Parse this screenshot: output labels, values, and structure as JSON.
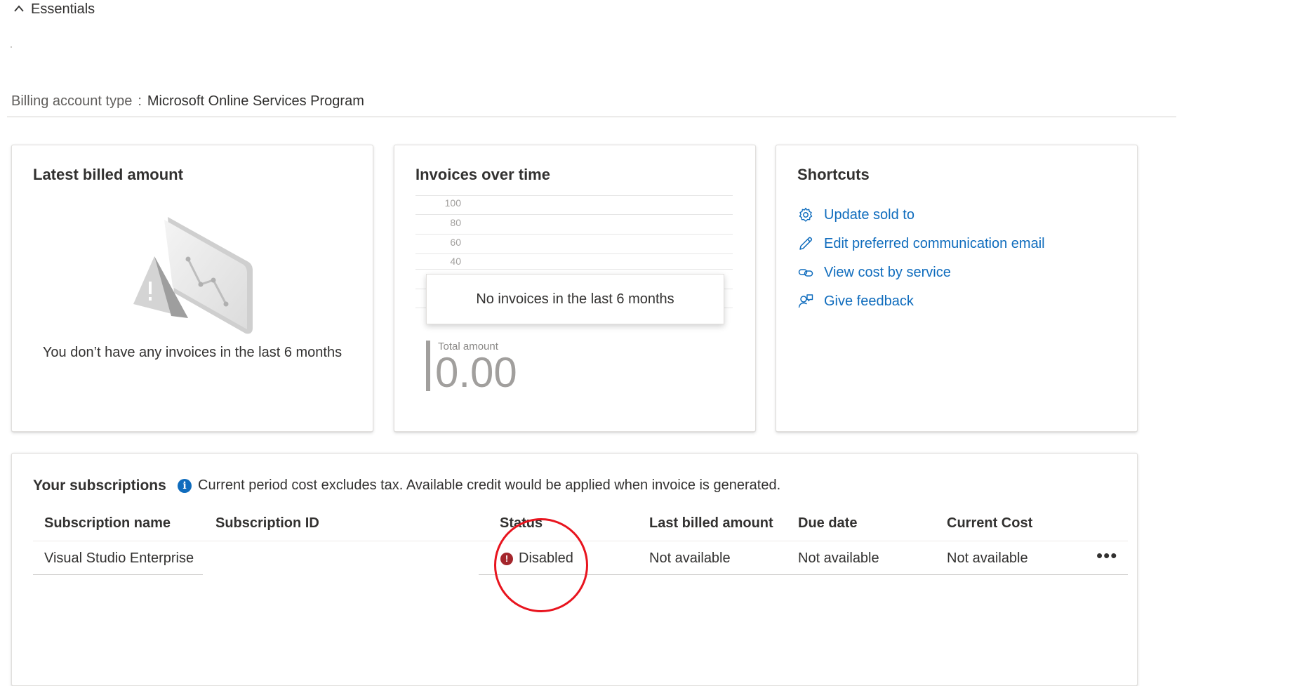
{
  "header": {
    "essentials_label": "Essentials"
  },
  "billing": {
    "label": "Billing account type",
    "separator": ":",
    "value": "Microsoft Online Services Program"
  },
  "latest_billed": {
    "title": "Latest billed amount",
    "empty_message": "You don’t have any invoices in the last 6 months"
  },
  "invoices": {
    "title": "Invoices over time",
    "ticks": [
      "100",
      "80",
      "60",
      "40"
    ],
    "tooltip": "No invoices in the last 6 months",
    "total_label": "Total amount",
    "total_value": "0.00"
  },
  "shortcuts": {
    "title": "Shortcuts",
    "items": [
      {
        "label": "Update sold to",
        "icon": "gear-icon"
      },
      {
        "label": "Edit preferred communication email",
        "icon": "pencil-icon"
      },
      {
        "label": "View cost by service",
        "icon": "link-icon"
      },
      {
        "label": "Give feedback",
        "icon": "feedback-icon"
      }
    ]
  },
  "subscriptions": {
    "title": "Your subscriptions",
    "info": "Current period cost excludes tax. Available credit would be applied when invoice is generated.",
    "columns": [
      "Subscription name",
      "Subscription ID",
      "Status",
      "Last billed amount",
      "Due date",
      "Current Cost"
    ],
    "rows": [
      {
        "name": "Visual Studio Enterprise",
        "id": "",
        "status": "Disabled",
        "last_billed": "Not available",
        "due_date": "Not available",
        "current_cost": "Not available"
      }
    ]
  },
  "colors": {
    "link": "#0f6cbd",
    "status_error": "#a4262c",
    "annotation": "#e8141e"
  }
}
